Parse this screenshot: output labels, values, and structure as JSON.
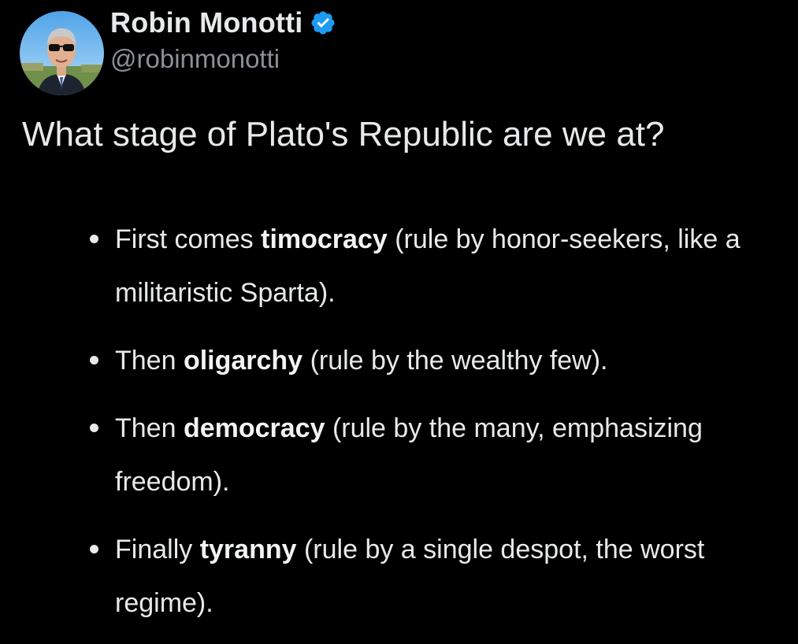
{
  "author": {
    "display_name": "Robin Monotti",
    "handle": "@robinmonotti",
    "verified": true,
    "verified_color": "#1d9bf0",
    "avatar_icon": "profile-photo"
  },
  "tweet": {
    "text": "What stage of Plato's Republic are we at?",
    "list_items": [
      {
        "prefix": "First comes ",
        "bold": "timocracy",
        "suffix": " (rule by honor-seekers, like a militaristic Sparta)."
      },
      {
        "prefix": "Then ",
        "bold": "oligarchy",
        "suffix": " (rule by the wealthy few)."
      },
      {
        "prefix": "Then ",
        "bold": "democracy",
        "suffix": " (rule by the many, emphasizing freedom)."
      },
      {
        "prefix": "Finally ",
        "bold": "tyranny",
        "suffix": " (rule by a single despot, the worst regime)."
      }
    ]
  },
  "theme": {
    "background": "#000000",
    "text_primary": "#e7e9ea",
    "text_secondary": "#8b9096"
  }
}
